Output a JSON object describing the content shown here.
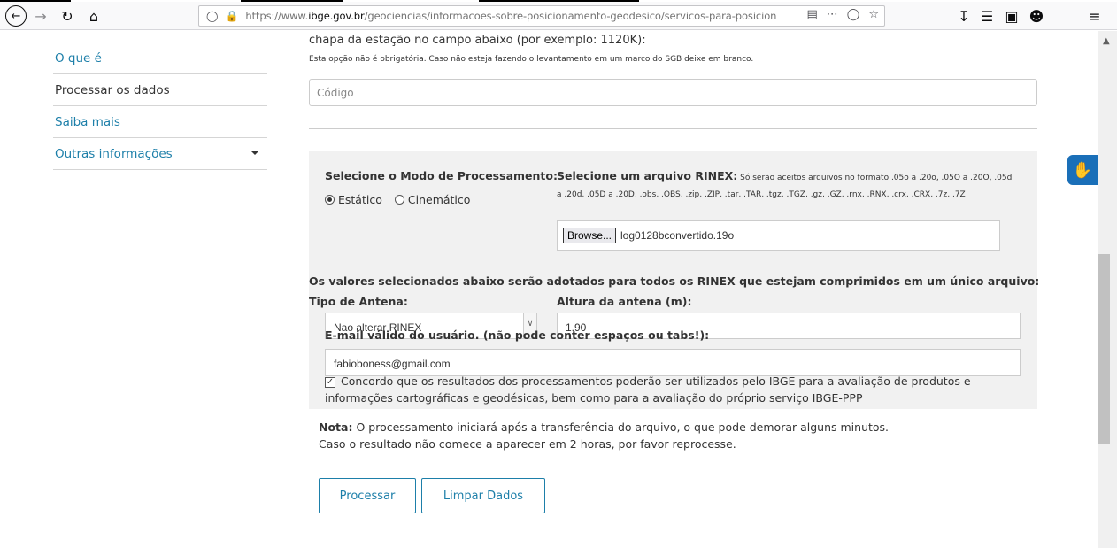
{
  "browser": {
    "url_prefix": "https://www.",
    "url_domain": "ibge.gov.br",
    "url_path": "/geociencias/informacoes-sobre-posicionamento-geodesico/servicos-para-posiciona",
    "icons": [
      "back-icon",
      "forward-icon",
      "reload-icon",
      "home-icon",
      "shield-icon",
      "lock-icon",
      "reader-view-icon",
      "more-icon",
      "pocket-icon",
      "bookmark-star-icon",
      "download-icon",
      "library-icon",
      "sidebar-icon",
      "account-icon",
      "menu-icon"
    ]
  },
  "sidebar": {
    "items": [
      {
        "label": "O que é",
        "active": false
      },
      {
        "label": "Processar os dados",
        "active": true
      },
      {
        "label": "Saiba mais",
        "active": false
      },
      {
        "label": "Outras informações",
        "active": false
      }
    ]
  },
  "form": {
    "cutoff_text": "chapa da estação no campo abaixo (por exemplo: 1120K):",
    "optional_note": "Esta opção não é obrigatória. Caso não esteja fazendo o levantamento em um marco do SGB deixe em branco.",
    "codigo_placeholder": "Código",
    "mode_label": "Selecione o Modo de Processamento:",
    "mode_static": "Estático",
    "mode_kinematic": "Cinemático",
    "rinex_label": "Selecione um arquivo RINEX:",
    "rinex_desc": "Só serão aceitos arquivos no formato .05o a .20o, .05O a .20O, .05d a .20d, .05D a .20D, .obs, .OBS, .zip, .ZIP, .tar, .TAR, .tgz, .TGZ, .gz, .GZ, .rnx, .RNX, .crx, .CRX, .7z, .7Z",
    "browse_label": "Browse...",
    "file_name": "log0128bconvertido.19o",
    "compressed_note": "Os valores selecionados abaixo serão adotados para todos os RINEX que estejam comprimidos em um único arquivo:",
    "antenna_type_label": "Tipo de Antena:",
    "antenna_type_value": "Nao alterar RINEX",
    "antenna_height_label": "Altura da antena (m):",
    "antenna_height_value": "1.90",
    "email_label": "E-mail válido do usuário. (não pode conter espaços ou tabs!):",
    "email_value": "fabioboness@gmail.com",
    "agree_text": "Concordo que os resultados dos processamentos poderão ser utilizados pelo IBGE para a avaliação de produtos e informações cartográficas e geodésicas, bem como para a avaliação do próprio serviço IBGE-PPP",
    "nota_label": "Nota:",
    "nota_line1": "O processamento iniciará após a transferência do arquivo, o que pode demorar alguns minutos.",
    "nota_line2": "Caso o resultado não comece a aparecer em 2 horas, por favor reprocesse.",
    "process_button": "Processar",
    "clear_button": "Limpar Dados"
  }
}
